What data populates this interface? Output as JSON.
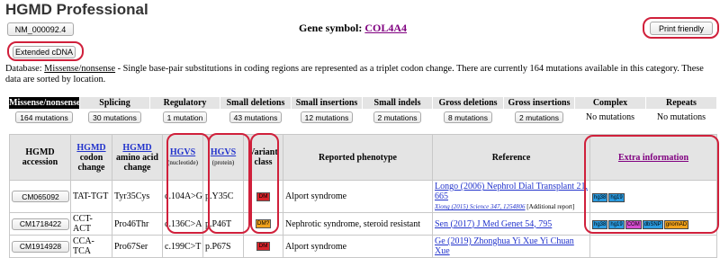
{
  "title": "HGMD Professional",
  "accession_box": "NM_000092.4",
  "gene_symbol_label": "Gene symbol:",
  "gene_symbol": "COL4A4",
  "print_friendly": "Print friendly",
  "extended_cdna": "Extended cDNA",
  "description": {
    "prefix": "Database: ",
    "category": "Missense/nonsense",
    "text": " - Single base-pair substitutions in coding regions are represented as a triplet codon change. There are currently 164 mutations available in this category. These data are sorted by location."
  },
  "categories": [
    {
      "label": "Missense/nonsense",
      "value": "164 mutations",
      "active": true,
      "button": true
    },
    {
      "label": "Splicing",
      "value": "30 mutations",
      "button": true
    },
    {
      "label": "Regulatory",
      "value": "1 mutation",
      "button": true
    },
    {
      "label": "Small deletions",
      "value": "43 mutations",
      "button": true
    },
    {
      "label": "Small insertions",
      "value": "12 mutations",
      "button": true
    },
    {
      "label": "Small indels",
      "value": "2 mutations",
      "button": true
    },
    {
      "label": "Gross deletions",
      "value": "8 mutations",
      "button": true
    },
    {
      "label": "Gross insertions",
      "value": "2 mutations",
      "button": true
    },
    {
      "label": "Complex",
      "value": "No mutations",
      "button": false
    },
    {
      "label": "Repeats",
      "value": "No mutations",
      "button": false
    }
  ],
  "table": {
    "headers": {
      "accession": "HGMD accession",
      "codon_link": "HGMD",
      "codon": "codon change",
      "amino_link": "HGMD",
      "amino": "amino acid change",
      "hgvs_nuc": "HGVS",
      "hgvs_nuc_sub": "(nucleotide)",
      "hgvs_prot": "HGVS",
      "hgvs_prot_sub": "(protein)",
      "variant_class": "Variant class",
      "phenotype": "Reported phenotype",
      "reference": "Reference",
      "extra": "Extra information"
    },
    "rows": [
      {
        "accession": "CM065092",
        "codon": "TAT-TGT",
        "amino": "Tyr35Cys",
        "hgvs_c": "c.104A>G",
        "hgvs_p": "p.Y35C",
        "class": "DM",
        "class_color": "#d8232a",
        "phenotype": "Alport syndrome",
        "ref_main": "Longo (2006) Nephrol Dial Transplant 21, 665",
        "ref_sub_link": "Xiong (2015) Science 347, 1254806",
        "ref_sub_extra": " [Additional report]",
        "extra": [
          "hg38",
          "hg19"
        ]
      },
      {
        "accession": "CM1718422",
        "codon": "CCT-ACT",
        "amino": "Pro46Thr",
        "hgvs_c": "c.136C>A",
        "hgvs_p": "p.P46T",
        "class": "DM?",
        "class_color": "#f1a21c",
        "phenotype": "Nephrotic syndrome, steroid resistant",
        "ref_main": "Sen (2017) J Med Genet 54, 795",
        "extra": [
          "hg38",
          "hg19",
          "COM",
          "dbSNP",
          "gnomAD"
        ]
      },
      {
        "accession": "CM1914928",
        "codon": "CCA-TCA",
        "amino": "Pro67Ser",
        "hgvs_c": "c.199C>T",
        "hgvs_p": "p.P67S",
        "class": "DM",
        "class_color": "#d8232a",
        "phenotype": "Alport syndrome",
        "ref_main": "Ge (2019) Zhonghua Yi Xue Yi Chuan Xue",
        "extra": []
      }
    ]
  },
  "colors": {
    "annotation": "#d0203b",
    "link": "#2233cc",
    "visited_link": "#800080"
  }
}
